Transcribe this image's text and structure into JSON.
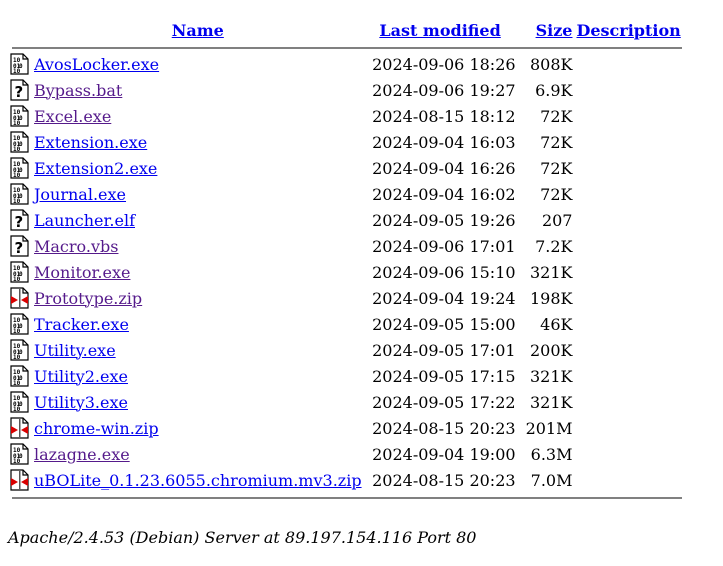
{
  "headers": {
    "name": "Name",
    "last_modified": "Last modified",
    "size": "Size",
    "description": "Description"
  },
  "files": [
    {
      "icon": "binary-file-icon",
      "name": "AvosLocker.exe",
      "modified": "2024-09-06 18:26",
      "size": "808K",
      "visited": false
    },
    {
      "icon": "unknown-file-icon",
      "name": "Bypass.bat",
      "modified": "2024-09-06 19:27",
      "size": "6.9K",
      "visited": true
    },
    {
      "icon": "binary-file-icon",
      "name": "Excel.exe",
      "modified": "2024-08-15 18:12",
      "size": "72K",
      "visited": true
    },
    {
      "icon": "binary-file-icon",
      "name": "Extension.exe",
      "modified": "2024-09-04 16:03",
      "size": "72K",
      "visited": false
    },
    {
      "icon": "binary-file-icon",
      "name": "Extension2.exe",
      "modified": "2024-09-04 16:26",
      "size": "72K",
      "visited": false
    },
    {
      "icon": "binary-file-icon",
      "name": "Journal.exe",
      "modified": "2024-09-04 16:02",
      "size": "72K",
      "visited": false
    },
    {
      "icon": "unknown-file-icon",
      "name": "Launcher.elf",
      "modified": "2024-09-05 19:26",
      "size": "207",
      "visited": false
    },
    {
      "icon": "unknown-file-icon",
      "name": "Macro.vbs",
      "modified": "2024-09-06 17:01",
      "size": "7.2K",
      "visited": true
    },
    {
      "icon": "binary-file-icon",
      "name": "Monitor.exe",
      "modified": "2024-09-06 15:10",
      "size": "321K",
      "visited": true
    },
    {
      "icon": "compressed-file-icon",
      "name": "Prototype.zip",
      "modified": "2024-09-04 19:24",
      "size": "198K",
      "visited": true
    },
    {
      "icon": "binary-file-icon",
      "name": "Tracker.exe",
      "modified": "2024-09-05 15:00",
      "size": "46K",
      "visited": false
    },
    {
      "icon": "binary-file-icon",
      "name": "Utility.exe",
      "modified": "2024-09-05 17:01",
      "size": "200K",
      "visited": false
    },
    {
      "icon": "binary-file-icon",
      "name": "Utility2.exe",
      "modified": "2024-09-05 17:15",
      "size": "321K",
      "visited": false
    },
    {
      "icon": "binary-file-icon",
      "name": "Utility3.exe",
      "modified": "2024-09-05 17:22",
      "size": "321K",
      "visited": false
    },
    {
      "icon": "compressed-file-icon",
      "name": "chrome-win.zip",
      "modified": "2024-08-15 20:23",
      "size": "201M",
      "visited": false
    },
    {
      "icon": "binary-file-icon",
      "name": "lazagne.exe",
      "modified": "2024-09-04 19:00",
      "size": "6.3M",
      "visited": true
    },
    {
      "icon": "compressed-file-icon",
      "name": "uBOLite_0.1.23.6055.chromium.mv3.zip",
      "modified": "2024-08-15 20:23",
      "size": "7.0M",
      "visited": false
    }
  ],
  "footer": "Apache/2.4.53 (Debian) Server at 89.197.154.116 Port 80",
  "colors": {
    "link": "#0000ee",
    "visited_link": "#551a8b",
    "rule": "#808080"
  }
}
